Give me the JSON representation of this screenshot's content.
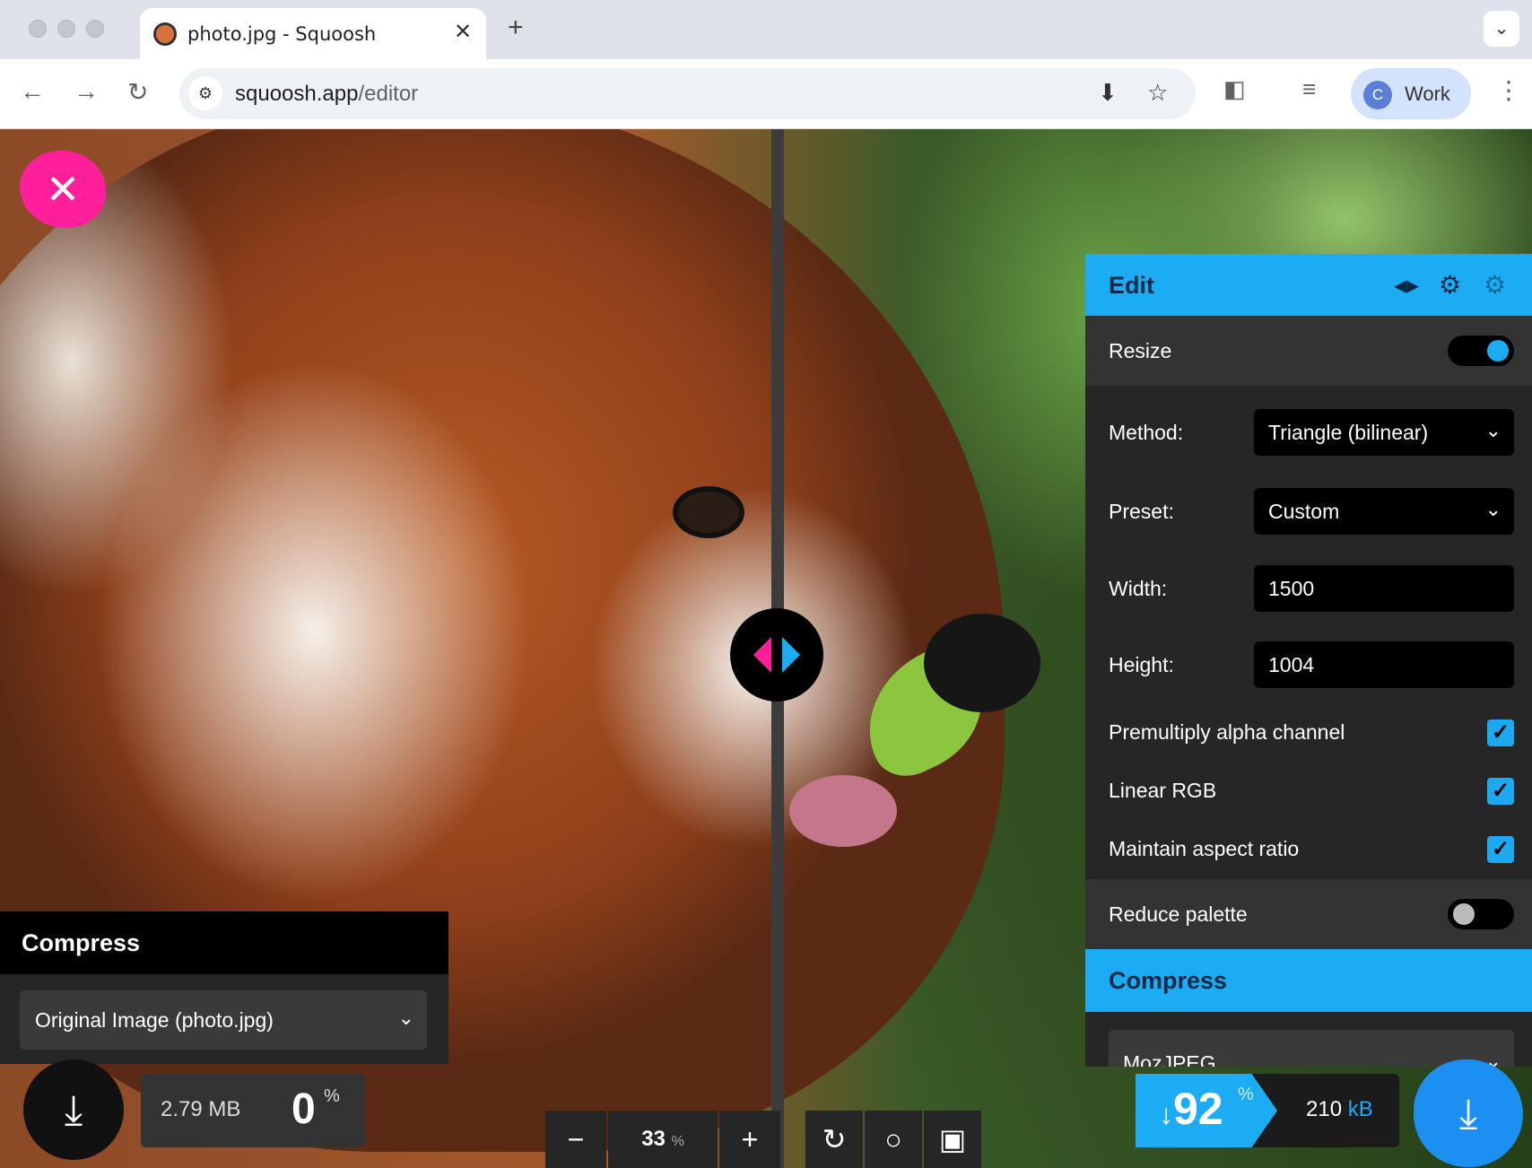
{
  "browser": {
    "tab_title": "photo.jpg - Squoosh",
    "tab_close": "✕",
    "new_tab": "+",
    "url_host": "squoosh.app",
    "url_path": "/editor",
    "profile_initial": "C",
    "profile_name": "Work",
    "icons": [
      "back-icon",
      "forward-icon",
      "reload-icon",
      "site-settings-icon",
      "install-icon",
      "star-icon",
      "extensions-icon",
      "media-icon",
      "menu-icon",
      "tab-search-icon"
    ]
  },
  "edit_panel": {
    "title": "Edit",
    "resize_label": "Resize",
    "resize_on": true,
    "method_label": "Method:",
    "method_value": "Triangle (bilinear)",
    "preset_label": "Preset:",
    "preset_value": "Custom",
    "width_label": "Width:",
    "width_value": "1500",
    "height_label": "Height:",
    "height_value": "1004",
    "premultiply_label": "Premultiply alpha channel",
    "linear_rgb_label": "Linear RGB",
    "aspect_label": "Maintain aspect ratio",
    "reduce_palette_label": "Reduce palette",
    "reduce_palette_on": false,
    "compress_title": "Compress",
    "codec_partial": "MozJPEG"
  },
  "left_panel": {
    "compress_title": "Compress",
    "select_value": "Original Image (photo.jpg)",
    "size": "2.79 MB",
    "percent_value": "0",
    "percent_sign": "%"
  },
  "zoom": {
    "minus": "−",
    "value": "33",
    "unit": "%",
    "plus": "+"
  },
  "result": {
    "arrow": "↓",
    "value": "92",
    "percent_sign": "%",
    "size_num": "210",
    "size_unit": "kB"
  },
  "colors": {
    "accent_blue": "#1bacf4",
    "pink": "#ff1f9a"
  }
}
